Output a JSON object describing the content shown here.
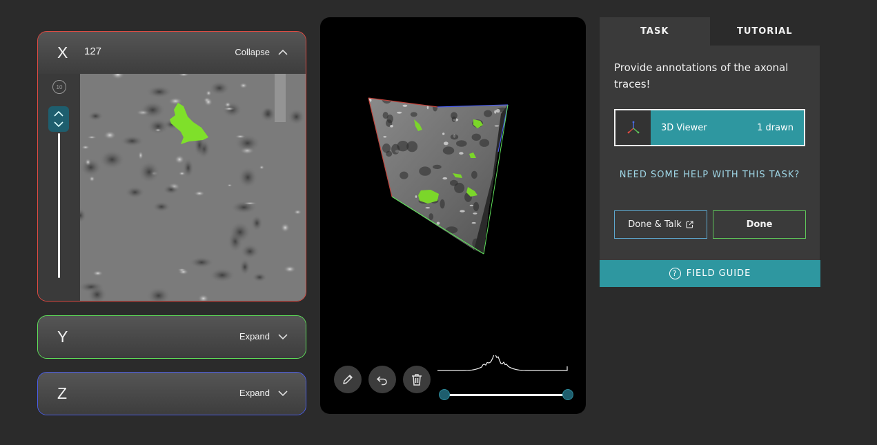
{
  "slices": {
    "x": {
      "axis": "X",
      "index": "127",
      "toggle_label": "Collapse",
      "border_color": "#e04a42"
    },
    "y": {
      "axis": "Y",
      "toggle_label": "Expand",
      "border_color": "#5fe05a"
    },
    "z": {
      "axis": "Z",
      "toggle_label": "Expand",
      "border_color": "#4a5de8"
    },
    "rewind_label": "10"
  },
  "viewer": {
    "tools": [
      "pencil-icon",
      "undo-icon",
      "trash-icon"
    ],
    "annotation_color": "#7bd62a"
  },
  "task_panel": {
    "tabs": [
      {
        "label": "TASK",
        "active": true
      },
      {
        "label": "TUTORIAL",
        "active": false
      }
    ],
    "instructions": "Provide annotations of the axonal traces!",
    "tool_option": {
      "label": "3D Viewer",
      "count": "1 drawn",
      "accent": "#2e97a0"
    },
    "help_link": "NEED SOME HELP WITH THIS TASK?",
    "buttons": {
      "done_talk": "Done & Talk",
      "done": "Done"
    },
    "field_guide": "FIELD GUIDE"
  }
}
